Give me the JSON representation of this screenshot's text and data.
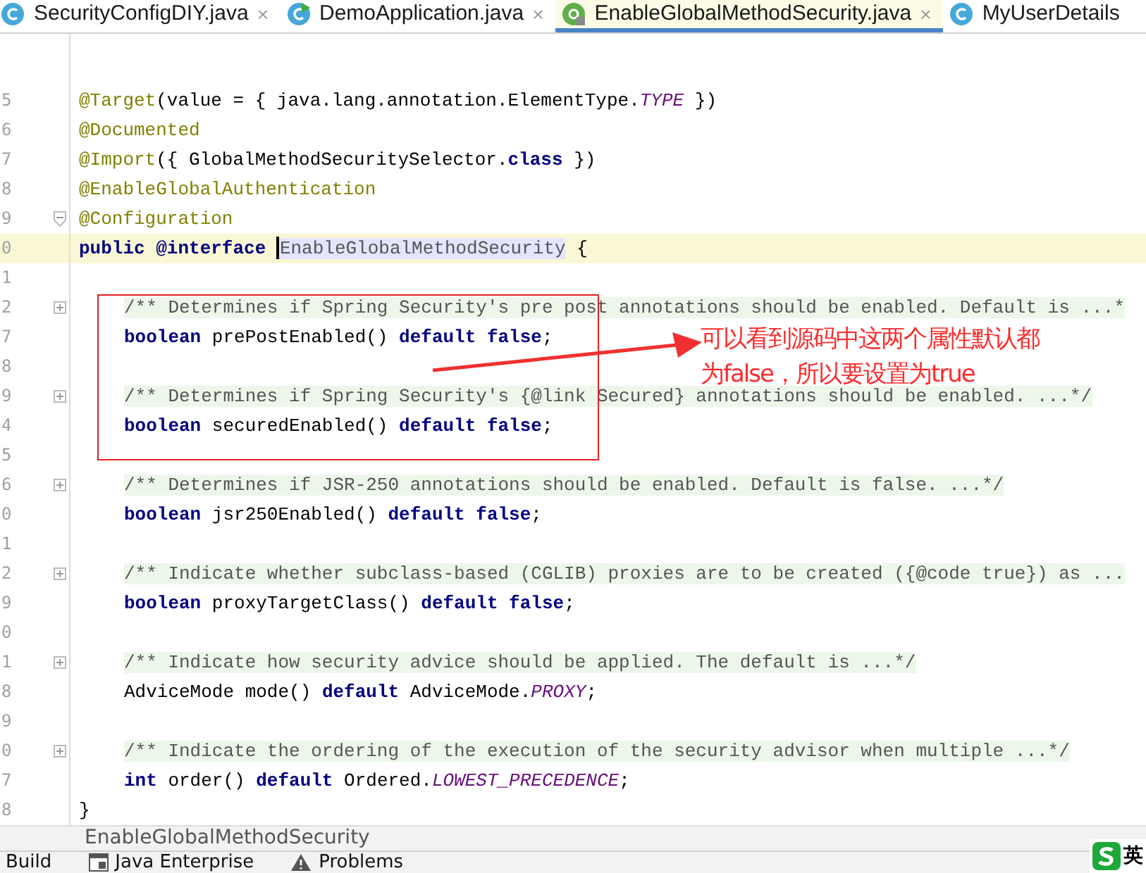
{
  "tabs": [
    {
      "label": "SecurityConfigDIY.java",
      "kind": "class",
      "selected": false,
      "close": "×"
    },
    {
      "label": "DemoApplication.java",
      "kind": "app",
      "selected": false,
      "close": "×"
    },
    {
      "label": "EnableGlobalMethodSecurity.java",
      "kind": "annotation",
      "selected": true,
      "close": "×"
    },
    {
      "label": "MyUserDetails",
      "kind": "class",
      "selected": false
    }
  ],
  "editor": {
    "lines": [
      {
        "number": "5",
        "current": false,
        "segments": [
          {
            "kind": "annotation",
            "text": "@Target"
          },
          {
            "kind": "plain",
            "text": "(value = { java.lang.annotation.ElementType."
          },
          {
            "kind": "constant",
            "text": "TYPE"
          },
          {
            "kind": "plain",
            "text": " })"
          }
        ]
      },
      {
        "number": "6",
        "current": false,
        "segments": [
          {
            "kind": "annotation",
            "text": "@Documented"
          }
        ]
      },
      {
        "number": "7",
        "current": false,
        "segments": [
          {
            "kind": "annotation",
            "text": "@Import"
          },
          {
            "kind": "plain",
            "text": "({ GlobalMethodSecuritySelector."
          },
          {
            "kind": "keyword",
            "text": "class"
          },
          {
            "kind": "plain",
            "text": " })"
          }
        ]
      },
      {
        "number": "8",
        "current": false,
        "segments": [
          {
            "kind": "annotation",
            "text": "@EnableGlobalAuthentication"
          }
        ]
      },
      {
        "number": "9",
        "current": false,
        "expanded": true,
        "segments": [
          {
            "kind": "annotation",
            "text": "@Configuration"
          }
        ]
      },
      {
        "number": "0",
        "current": true,
        "segments": [
          {
            "kind": "keyword",
            "text": "public @interface "
          },
          {
            "kind": "caret"
          },
          {
            "kind": "symbol",
            "text": "EnableGlobalMethodSecurity"
          },
          {
            "kind": "plain",
            "text": " {"
          }
        ]
      },
      {
        "number": "1",
        "current": false
      },
      {
        "number": "2",
        "current": false,
        "expanded": false,
        "indent": true,
        "segments": [
          {
            "kind": "comment",
            "text": "/** Determines if Spring Security's pre post annotations should be enabled. Default is ...*"
          }
        ]
      },
      {
        "number": "7",
        "current": false,
        "indent": true,
        "segments": [
          {
            "kind": "keyword",
            "text": "boolean"
          },
          {
            "kind": "plain",
            "text": " prePostEnabled() "
          },
          {
            "kind": "keyword",
            "text": "default false"
          },
          {
            "kind": "plain",
            "text": ";"
          }
        ]
      },
      {
        "number": "8",
        "current": false
      },
      {
        "number": "9",
        "current": false,
        "expanded": false,
        "indent": true,
        "segments": [
          {
            "kind": "comment",
            "text": "/** Determines if Spring Security's {@link Secured} annotations should be enabled. ...*/"
          }
        ]
      },
      {
        "number": "4",
        "current": false,
        "indent": true,
        "segments": [
          {
            "kind": "keyword",
            "text": "boolean"
          },
          {
            "kind": "plain",
            "text": " securedEnabled() "
          },
          {
            "kind": "keyword",
            "text": "default false"
          },
          {
            "kind": "plain",
            "text": ";"
          }
        ]
      },
      {
        "number": "5",
        "current": false
      },
      {
        "number": "6",
        "current": false,
        "expanded": false,
        "indent": true,
        "segments": [
          {
            "kind": "comment",
            "text": "/** Determines if JSR-250 annotations should be enabled. Default is false. ...*/"
          }
        ]
      },
      {
        "number": "0",
        "current": false,
        "indent": true,
        "segments": [
          {
            "kind": "keyword",
            "text": "boolean"
          },
          {
            "kind": "plain",
            "text": " jsr250Enabled() "
          },
          {
            "kind": "keyword",
            "text": "default false"
          },
          {
            "kind": "plain",
            "text": ";"
          }
        ]
      },
      {
        "number": "1",
        "current": false
      },
      {
        "number": "2",
        "current": false,
        "expanded": false,
        "indent": true,
        "segments": [
          {
            "kind": "comment",
            "text": "/** Indicate whether subclass-based (CGLIB) proxies are to be created ({@code true}) as ..."
          }
        ]
      },
      {
        "number": "9",
        "current": false,
        "indent": true,
        "segments": [
          {
            "kind": "keyword",
            "text": "boolean"
          },
          {
            "kind": "plain",
            "text": " proxyTargetClass() "
          },
          {
            "kind": "keyword",
            "text": "default false"
          },
          {
            "kind": "plain",
            "text": ";"
          }
        ]
      },
      {
        "number": "0",
        "current": false
      },
      {
        "number": "1",
        "current": false,
        "expanded": false,
        "indent": true,
        "segments": [
          {
            "kind": "comment",
            "text": "/** Indicate how security advice should be applied. The default is ...*/"
          }
        ]
      },
      {
        "number": "8",
        "current": false,
        "indent": true,
        "segments": [
          {
            "kind": "plain",
            "text": "AdviceMode mode() "
          },
          {
            "kind": "keyword",
            "text": "default"
          },
          {
            "kind": "plain",
            "text": " AdviceMode."
          },
          {
            "kind": "constant",
            "text": "PROXY"
          },
          {
            "kind": "plain",
            "text": ";"
          }
        ]
      },
      {
        "number": "9",
        "current": false
      },
      {
        "number": "0",
        "current": false,
        "expanded": false,
        "indent": true,
        "segments": [
          {
            "kind": "comment",
            "text": "/** Indicate the ordering of the execution of the security advisor when multiple ...*/"
          }
        ]
      },
      {
        "number": "7",
        "current": false,
        "indent": true,
        "segments": [
          {
            "kind": "keyword",
            "text": "int"
          },
          {
            "kind": "plain",
            "text": " order() "
          },
          {
            "kind": "keyword",
            "text": "default"
          },
          {
            "kind": "plain",
            "text": " Ordered."
          },
          {
            "kind": "constant",
            "text": "LOWEST_PRECEDENCE"
          },
          {
            "kind": "plain",
            "text": ";"
          }
        ]
      },
      {
        "number": "8",
        "current": false,
        "segments": [
          {
            "kind": "plain",
            "text": "}"
          }
        ]
      }
    ]
  },
  "callout": {
    "lines": [
      "可以看到源码中这两个属性默认都",
      "为false，所以要设置为true"
    ]
  },
  "breadcrumb": "EnableGlobalMethodSecurity",
  "tool_windows": [
    {
      "label": "Build",
      "kind": "build"
    },
    {
      "label": "Java Enterprise",
      "kind": "enterprise"
    },
    {
      "label": "Problems",
      "kind": "problems"
    }
  ],
  "ime_indicator": {
    "label": "英"
  }
}
